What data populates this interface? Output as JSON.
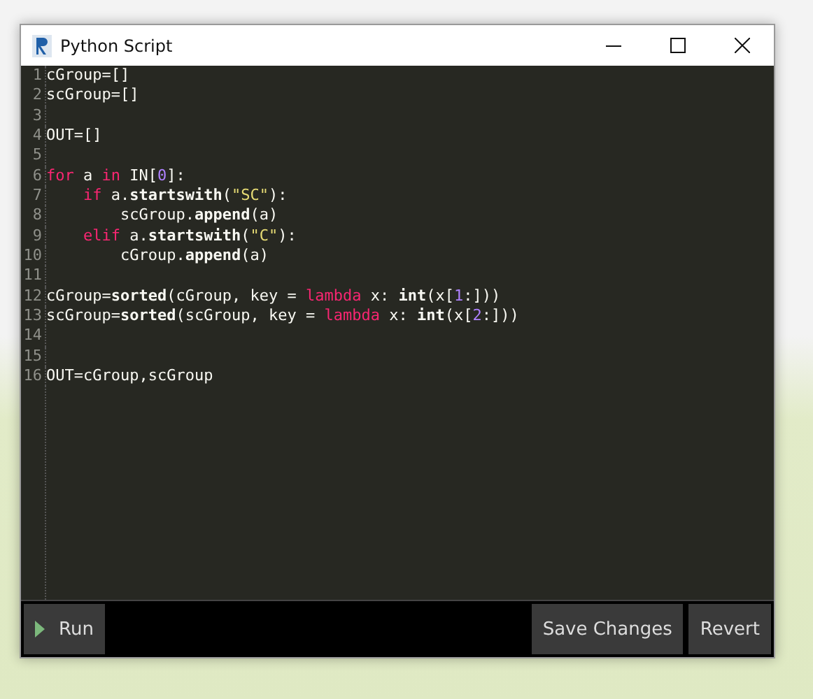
{
  "window": {
    "title": "Python Script"
  },
  "code_lines": [
    {
      "number": "1",
      "kind": "top",
      "tokens": [
        {
          "kind": "plain",
          "text": "cGroup=[]"
        }
      ]
    },
    {
      "number": "2",
      "kind": "top",
      "tokens": [
        {
          "kind": "plain",
          "text": "scGroup=[]"
        }
      ]
    },
    {
      "number": "3"
    },
    {
      "number": "4",
      "kind": "top",
      "tokens": [
        {
          "kind": "plain",
          "text": "OUT=[]"
        }
      ]
    },
    {
      "number": "5"
    },
    {
      "number": "6",
      "kind": "top",
      "tokens": [
        {
          "kind": "keyword",
          "text": "for"
        },
        {
          "kind": "plain",
          "text": " a "
        },
        {
          "kind": "keyword",
          "text": "in"
        },
        {
          "kind": "plain",
          "text": " IN["
        },
        {
          "kind": "number",
          "text": "0"
        },
        {
          "kind": "plain",
          "text": "]:"
        }
      ]
    },
    {
      "number": "7",
      "kind": "indented",
      "tokens": [
        {
          "kind": "keyword",
          "text": "if"
        },
        {
          "kind": "plain",
          "text": " a."
        },
        {
          "kind": "builtin",
          "text": "startswith"
        },
        {
          "kind": "plain",
          "text": "("
        },
        {
          "kind": "string",
          "text": "\"SC\""
        },
        {
          "kind": "plain",
          "text": "):"
        }
      ]
    },
    {
      "number": "8",
      "kind": "nested",
      "tokens": [
        {
          "kind": "plain",
          "text": "scGroup."
        },
        {
          "kind": "builtin",
          "text": "append"
        },
        {
          "kind": "plain",
          "text": "(a)"
        }
      ]
    },
    {
      "number": "9",
      "kind": "indented",
      "tokens": [
        {
          "kind": "keyword",
          "text": "elif"
        },
        {
          "kind": "plain",
          "text": " a."
        },
        {
          "kind": "builtin",
          "text": "startswith"
        },
        {
          "kind": "plain",
          "text": "("
        },
        {
          "kind": "string",
          "text": "\"C\""
        },
        {
          "kind": "plain",
          "text": "):"
        }
      ]
    },
    {
      "number": "10",
      "kind": "nested",
      "tokens": [
        {
          "kind": "plain",
          "text": "cGroup."
        },
        {
          "kind": "builtin",
          "text": "append"
        },
        {
          "kind": "plain",
          "text": "(a)"
        }
      ]
    },
    {
      "number": "11"
    },
    {
      "number": "12",
      "kind": "top",
      "tokens": [
        {
          "kind": "plain",
          "text": "cGroup="
        },
        {
          "kind": "builtin",
          "text": "sorted"
        },
        {
          "kind": "plain",
          "text": "(cGroup, key = "
        },
        {
          "kind": "keyword",
          "text": "lambda"
        },
        {
          "kind": "plain",
          "text": " x: "
        },
        {
          "kind": "builtin",
          "text": "int"
        },
        {
          "kind": "plain",
          "text": "(x["
        },
        {
          "kind": "number",
          "text": "1"
        },
        {
          "kind": "plain",
          "text": ":]))"
        }
      ]
    },
    {
      "number": "13",
      "kind": "top",
      "tokens": [
        {
          "kind": "plain",
          "text": "scGroup="
        },
        {
          "kind": "builtin",
          "text": "sorted"
        },
        {
          "kind": "plain",
          "text": "(scGroup, key = "
        },
        {
          "kind": "keyword",
          "text": "lambda"
        },
        {
          "kind": "plain",
          "text": " x: "
        },
        {
          "kind": "builtin",
          "text": "int"
        },
        {
          "kind": "plain",
          "text": "(x["
        },
        {
          "kind": "number",
          "text": "2"
        },
        {
          "kind": "plain",
          "text": ":]))"
        }
      ]
    },
    {
      "number": "14"
    },
    {
      "number": "15"
    },
    {
      "number": "16",
      "kind": "top",
      "tokens": [
        {
          "kind": "plain",
          "text": "OUT=cGroup,scGroup"
        }
      ]
    }
  ],
  "buttons": {
    "run": "Run",
    "save": "Save Changes",
    "revert": "Revert"
  }
}
